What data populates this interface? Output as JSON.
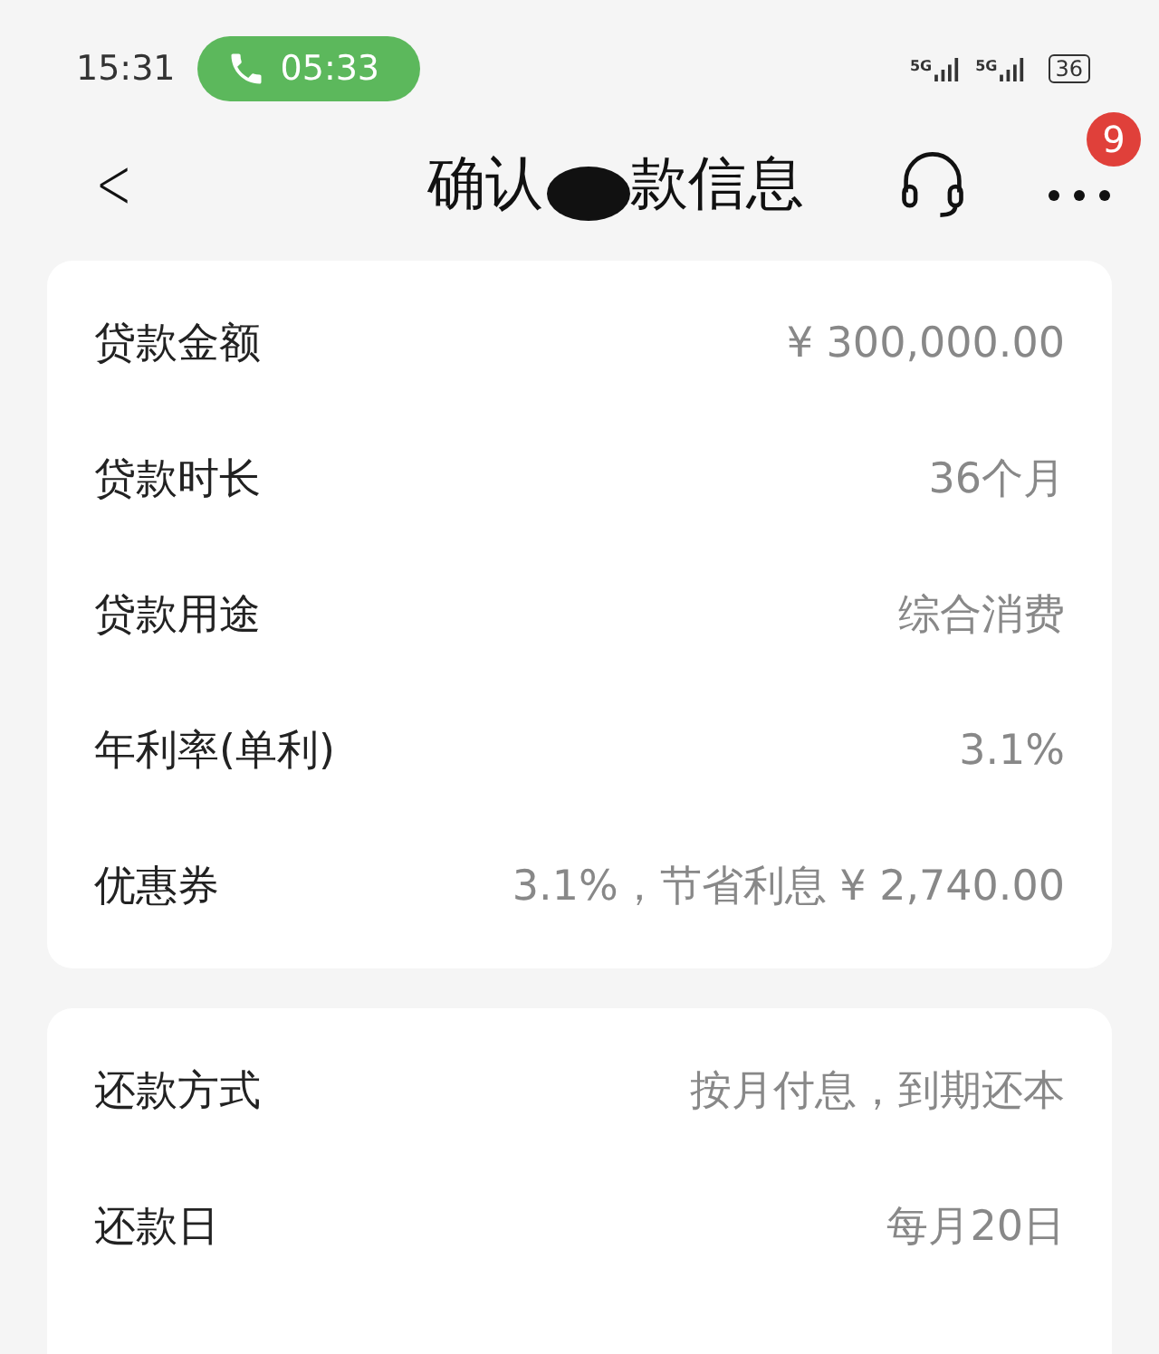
{
  "status_bar": {
    "time": "15:31",
    "call_timer": "05:33",
    "signals": [
      {
        "label": "5G"
      },
      {
        "label": "5G"
      }
    ],
    "battery": "36"
  },
  "header": {
    "back": "<",
    "title_parts": [
      "确认",
      "款信息"
    ],
    "badge": "9"
  },
  "sections": [
    {
      "rows": [
        {
          "label": "贷款金额",
          "value": "¥ 300,000.00"
        },
        {
          "label": "贷款时长",
          "value": "36个月"
        },
        {
          "label": "贷款用途",
          "value": "综合消费"
        },
        {
          "label": "年利率(单利)",
          "value": "3.1%"
        },
        {
          "label": "优惠券",
          "value": "3.1%，节省利息 ¥ 2,740.00"
        }
      ]
    },
    {
      "rows": [
        {
          "label": "还款方式",
          "value": "按月付息，到期还本"
        },
        {
          "label": "还款日",
          "value": "每月20日"
        }
      ]
    }
  ]
}
